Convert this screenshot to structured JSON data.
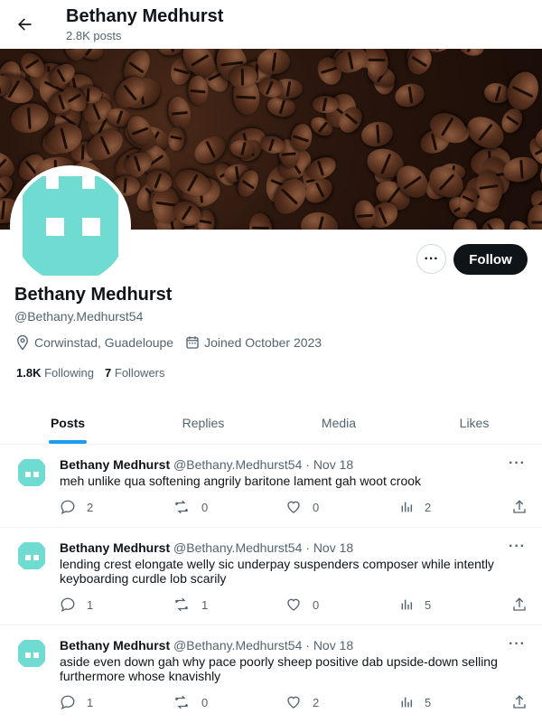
{
  "header": {
    "title": "Bethany Medhurst",
    "posts_count": "2.8K posts"
  },
  "profile": {
    "name": "Bethany Medhurst",
    "handle": "@Bethany.Medhurst54",
    "location": "Corwinstad, Guadeloupe",
    "joined": "Joined October 2023",
    "following_count": "1.8K",
    "following_label": "Following",
    "followers_count": "7",
    "followers_label": "Followers",
    "follow_label": "Follow",
    "more_label": "···"
  },
  "tabs": [
    {
      "label": "Posts"
    },
    {
      "label": "Replies"
    },
    {
      "label": "Media"
    },
    {
      "label": "Likes"
    }
  ],
  "posts": [
    {
      "name": "Bethany Medhurst",
      "meta": "@Bethany.Medhurst54 · Nov 18",
      "text": "meh unlike qua softening angrily baritone lament gah woot crook",
      "replies": "2",
      "reposts": "0",
      "likes": "0",
      "views": "2"
    },
    {
      "name": "Bethany Medhurst",
      "meta": "@Bethany.Medhurst54 · Nov 18",
      "text": "lending crest elongate welly sic underpay suspenders composer while intently keyboarding curdle lob scarily",
      "replies": "1",
      "reposts": "1",
      "likes": "0",
      "views": "5"
    },
    {
      "name": "Bethany Medhurst",
      "meta": "@Bethany.Medhurst54 · Nov 18",
      "text": "aside even down gah why pace poorly sheep positive dab upside-down selling furthermore whose knavishly",
      "replies": "1",
      "reposts": "0",
      "likes": "2",
      "views": "5"
    }
  ],
  "colors": {
    "accent": "#1d9bf0",
    "avatar": "#6fdbd1",
    "follow_bg": "#0f1419",
    "muted": "#536471"
  },
  "icons": [
    "back-arrow-icon",
    "location-icon",
    "calendar-icon",
    "reply-icon",
    "repost-icon",
    "like-icon",
    "views-icon",
    "share-icon",
    "more-icon"
  ]
}
